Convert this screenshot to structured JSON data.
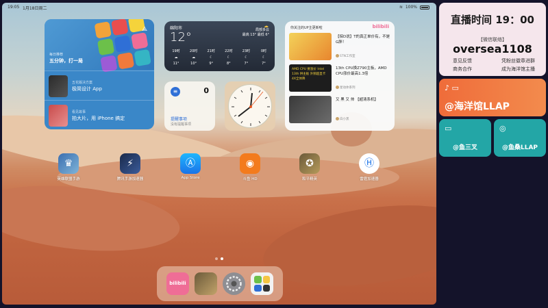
{
  "status_bar": {
    "time": "19:05",
    "date": "1月18日周二",
    "battery": "100%"
  },
  "appstore_widget": {
    "top_small": "每日推荐",
    "top_big": "五分钟，打一局",
    "rows": [
      {
        "small": "五花版决方案",
        "big": "极简设计 App"
      },
      {
        "small": "看见故事",
        "big": "拍大片，用 iPhone 搞定"
      }
    ]
  },
  "weather": {
    "city": "绵阳市",
    "temp": "12°",
    "condition": "局部多云",
    "hilo": "最高 13° 最低 6°",
    "hours": [
      {
        "time": "19时",
        "temp": "11°"
      },
      {
        "time": "20时",
        "temp": "10°"
      },
      {
        "time": "21时",
        "temp": "9°"
      },
      {
        "time": "22时",
        "temp": "8°"
      },
      {
        "time": "23时",
        "temp": "7°"
      },
      {
        "time": "0时",
        "temp": "7°"
      }
    ]
  },
  "reminders": {
    "count": "0",
    "title": "提醒事项",
    "subtitle": "没有提醒事项"
  },
  "bilibili_widget": {
    "header": "你关注的UP主更新啦",
    "logo": "bilibili",
    "items": [
      {
        "title": "【探D说】T的真正单价有，不是G胖！",
        "up": "STN工作室",
        "img_text": ""
      },
      {
        "title": "13th CPU换Z790主板，AMD CPU涨价最高1.3倍",
        "up": "星动体系列",
        "img_text": "AMD CPU 要涨价 Intel 13th 供主板 外频超显卡4X全体降"
      },
      {
        "title": "又 黑 又 帅 【超清系机】",
        "up": "白小黑",
        "img_text": ""
      }
    ]
  },
  "apps": [
    {
      "label": "英雄联盟手游"
    },
    {
      "label": "腾讯手游加速器"
    },
    {
      "label": "App Store"
    },
    {
      "label": "斗鱼 HD"
    },
    {
      "label": "和平精英"
    },
    {
      "label": "雷霆加速器"
    }
  ],
  "dock": [
    "bilibili",
    "和平精英",
    "设置",
    "快捷指令"
  ],
  "live_panel": {
    "time": "直播时间 19：00",
    "contact": "【微信联络】",
    "id": "oversea1108",
    "row1_left": "意见反馈",
    "row1_right": "凭粉丝徽章进群",
    "row2_left": "商务合作",
    "row2_right": "成为海洋馆主播"
  },
  "douyin_panel": {
    "name": "@海洋馆LLAP"
  },
  "small_panels": [
    {
      "name": "@鱼三叉"
    },
    {
      "name": "@鱼桑LLAP"
    }
  ],
  "colors": {
    "accent_orange": "#ef6c3a",
    "accent_teal": "#23a6a6",
    "bili_pink": "#ef6d96",
    "live_bg": "#f5e6ec"
  }
}
